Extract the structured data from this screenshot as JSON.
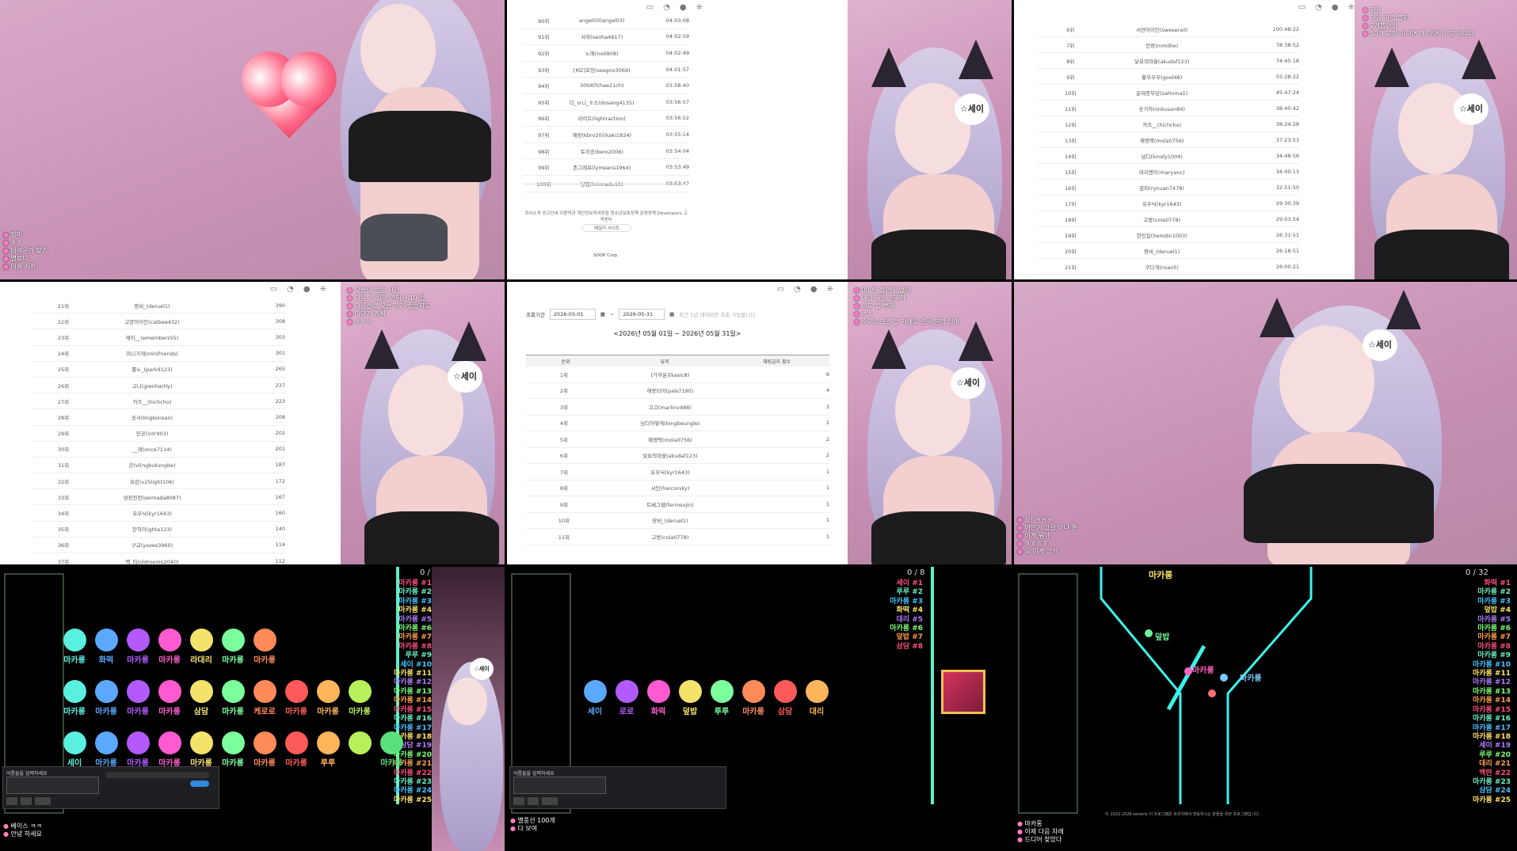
{
  "panel1": {
    "chat": [
      "장미",
      "ㅎㅎ",
      "어려운거 찾기",
      "별로다",
      "이제 시작"
    ]
  },
  "panel2": {
    "rows": [
      {
        "rank": "90위",
        "name": "angel03(angel03)",
        "time": "04:03:08"
      },
      {
        "rank": "91위",
        "name": "서하(seoha4617)",
        "time": "04:02:59"
      },
      {
        "rank": "92위",
        "name": "노에(no0808)",
        "time": "04:02:49"
      },
      {
        "rank": "93위",
        "name": "[MZ]초잉(sesgno3069)",
        "time": "04:01:57"
      },
      {
        "rank": "94위",
        "name": "3004(fchae21ch)",
        "time": "03:58:40"
      },
      {
        "rank": "95위",
        "name": "디_ㅂ니_ㅎ스(dosang4135)",
        "time": "03:56:57"
      },
      {
        "rank": "96위",
        "name": "라이트(lightraction)",
        "time": "03:56:52"
      },
      {
        "rank": "97위",
        "name": "해랑(kbrv20)(kaki1824)",
        "time": "03:55:14"
      },
      {
        "rank": "98위",
        "name": "토끼공(bero2006)",
        "time": "03:54:04"
      },
      {
        "rank": "99위",
        "name": "존그래프(lymeans1964)",
        "time": "03:53:49"
      },
      {
        "rank": "100위",
        "name": "당첨(hinmadu10)",
        "time": "03:53:47"
      }
    ],
    "footer_links": "회사소개  광고안내  이용약관  개인정보처리방침  청소년보호정책  운영정책  Developers  고객센터",
    "footer_button": "패밀리 사이트",
    "brand": "SOOP Corp."
  },
  "panel3": {
    "rows": [
      {
        "rank": "6위",
        "name": "서연아이인(sweserail)",
        "time": "100:48:22"
      },
      {
        "rank": "7위",
        "name": "민랑(mmillie)",
        "time": "78:38:52"
      },
      {
        "rank": "8위",
        "name": "닻묘의마을(akudaf123)",
        "time": "74:45:18"
      },
      {
        "rank": "9위",
        "name": "황우우우(gool48)",
        "time": "55:28:22"
      },
      {
        "rank": "10위",
        "name": "운래종무당(sahnma1)",
        "time": "45:47:24"
      },
      {
        "rank": "11위",
        "name": "송가하(onkusan84)",
        "time": "38:40:42"
      },
      {
        "rank": "12위",
        "name": "카즈__(hichcho)",
        "time": "38:24:28"
      },
      {
        "rank": "13위",
        "name": "해영택(mola0756)",
        "time": "37:23:53"
      },
      {
        "rank": "14위",
        "name": "넘디(kinsly1004)",
        "time": "34:48:56"
      },
      {
        "rank": "15위",
        "name": "마리앤이(maryanc)",
        "time": "34:00:13"
      },
      {
        "rank": "16위",
        "name": "준타(rynuan7478)",
        "time": "32:51:50"
      },
      {
        "rank": "17위",
        "name": "유우닉(kyr1643)",
        "time": "29:30:39"
      },
      {
        "rank": "18위",
        "name": "고랑(cola0778)",
        "time": "29:03:54"
      },
      {
        "rank": "19위",
        "name": "한민집(hemdin1003)",
        "time": "26:31:51"
      },
      {
        "rank": "20위",
        "name": "팡비_(deruel1)",
        "time": "26:18:51"
      },
      {
        "rank": "21위",
        "name": "쿠다게(nsao5)",
        "time": "26:00:21"
      },
      {
        "rank": "22위",
        "name": "구그아(kimhvan)",
        "time": "24:16:27"
      }
    ],
    "chat": [
      "자유",
      "다음 이것 뽑기",
      "2개뽑아봐",
      "50개 교환 아니면 개 하면 거 또 아니다"
    ]
  },
  "panel4": {
    "rows": [
      {
        "rank": "21위",
        "name": "팡비_(deruel1)",
        "count": "390"
      },
      {
        "rank": "22위",
        "name": "고양이이인(catbee432)",
        "count": "308"
      },
      {
        "rank": "23위",
        "name": "케이__(emembers55)",
        "count": "303"
      },
      {
        "rank": "24위",
        "name": "미니가게(minifriends)",
        "count": "301"
      },
      {
        "rank": "25위",
        "name": "롤노_(park9123)",
        "count": "265"
      },
      {
        "rank": "26위",
        "name": "고니(grenhartly)",
        "count": "237"
      },
      {
        "rank": "27위",
        "name": "카즈__(hichcho)",
        "count": "223"
      },
      {
        "rank": "28위",
        "name": "송사(lingkonsan)",
        "count": "208"
      },
      {
        "rank": "29위",
        "name": "인공(intr903)",
        "count": "202"
      },
      {
        "rank": "30위",
        "name": "__래(once7114)",
        "count": "201"
      },
      {
        "rank": "31위",
        "name": "강(vl(ngbuksngbe)",
        "count": "187"
      },
      {
        "rank": "32위",
        "name": "유린(v25light106)",
        "count": "172"
      },
      {
        "rank": "33위",
        "name": "냉정전전(seimada8087)",
        "count": "167"
      },
      {
        "rank": "34위",
        "name": "유우닉(kyr1643)",
        "count": "160"
      },
      {
        "rank": "35위",
        "name": "찬히아(ghta123)",
        "count": "140"
      },
      {
        "rank": "36위",
        "name": "구교(yaxes3960)",
        "count": "114"
      },
      {
        "rank": "37위",
        "name": "백_미(oldmemo2040)",
        "count": "112"
      }
    ],
    "chat": [
      "오늘의 방송 시간",
      "다음 거 뭘까 안되서 10 걸",
      "다음걸로 오늘 하기 좋을지도",
      "이야기 계획",
      "ㅎㅎㅎ"
    ]
  },
  "panel5": {
    "period_label": "조회기간",
    "date_from": "2026-05-01",
    "date_to": "2026-05-31",
    "period_note": "최근 1년 데이터만 조회 가능합니다.",
    "heading": "<2026년 05월 01일 ~ 2026년 05월 31일>",
    "columns": [
      "순위",
      "유저",
      "채팅금지 횟수"
    ],
    "rows": [
      {
        "rank": "1위",
        "name": "[가까운](kasic8)",
        "count": "9"
      },
      {
        "rank": "2위",
        "name": "해랑되어(pals7190)",
        "count": "4"
      },
      {
        "rank": "3위",
        "name": "끄끄(marlinv488)",
        "count": "3"
      },
      {
        "rank": "4위",
        "name": "넘디어떻게(longbeungle)",
        "count": "2"
      },
      {
        "rank": "5위",
        "name": "해영택(mola0756)",
        "count": "2"
      },
      {
        "rank": "6위",
        "name": "닻묘의마을(akudaf123)",
        "count": "2"
      },
      {
        "rank": "7위",
        "name": "유우닉(kyr1643)",
        "count": "1"
      },
      {
        "rank": "8위",
        "name": "서민(harcorsky)",
        "count": "1"
      },
      {
        "rank": "9위",
        "name": "트베그웹(ferrosojin)",
        "count": "1"
      },
      {
        "rank": "10위",
        "name": "팡비_(deruel1)",
        "count": "1"
      },
      {
        "rank": "11위",
        "name": "고랑(cola0778)",
        "count": "1"
      }
    ],
    "chat": [
      "00 한 잠깐에 없대",
      "내가 제일 진짜에",
      "나도 할 뻔해",
      "ㅎㅎ",
      "주의 0.3일 할 거예요 결국 분명 있어"
    ]
  },
  "panel6": {
    "chat": [
      "오! ㅋㅋㅋ",
      "어떤거 그걸 아냐 뭔",
      "이게 뭐야",
      "ㅎㅎㅎㅎ",
      "오 이게 그거"
    ]
  },
  "panel7": {
    "count": "0 / 27",
    "rank_list": [
      "마카롱 #1",
      "마카롱 #2",
      "마카롱 #3",
      "마카롱 #4",
      "마카롱 #5",
      "마카롱 #6",
      "마카롱 #7",
      "마카롱 #8",
      "루루 #9",
      "세이 #10",
      "마카롱 #11",
      "마카롱 #12",
      "마카롱 #13",
      "마카롱 #14",
      "마카롱 #15",
      "마카롱 #16",
      "마카롱 #17",
      "마카롱 #18",
      "삼담 #19",
      "마카롱 #20",
      "마카롱 #21",
      "마카롱 #22",
      "마카롱 #23",
      "마카롱 #24",
      "마카롱 #25"
    ],
    "row1": [
      "마카롱",
      "화떡",
      "마카롱",
      "마카롱",
      "라대리",
      "마카롱",
      "마카롱"
    ],
    "row2": [
      "마카롱",
      "마카롱",
      "마카롱",
      "마카롱",
      "삼담",
      "마카롱",
      "케로로",
      "마카롱",
      "마카롱",
      "마카롱"
    ],
    "row3": [
      "세이",
      "마카롱",
      "마카롱",
      "마카롱",
      "마카롱",
      "마카롱",
      "마카롱",
      "마카롱",
      "루루",
      "",
      "마카롱"
    ],
    "input_label": "이름들을 입력하세요",
    "chat": [
      "베이스 ㅋㅋ",
      "안녕 하세요"
    ]
  },
  "panel8": {
    "count": "0 / 8",
    "rank_list": [
      "세이 #1",
      "루루 #2",
      "마카롱 #3",
      "화떡 #4",
      "대리 #5",
      "마카롱 #6",
      "덮밥 #7",
      "삼담 #8"
    ],
    "balls": [
      "세이",
      "로로",
      "화떡",
      "덮밥",
      "루루",
      "마카롱",
      "삼담",
      "대리"
    ],
    "input_label": "이름들을 입력하세요",
    "chat": [
      "별풍선 100개",
      "다 보여"
    ]
  },
  "panel9": {
    "count": "0 / 32",
    "top_label": "마카롱",
    "labels": [
      "덮밥",
      "마카롱",
      "마카롱"
    ],
    "rank_list": [
      "화떡 #1",
      "마카롱 #2",
      "마카롱 #3",
      "덮밥 #4",
      "마카롱 #5",
      "마카롱 #6",
      "마카롱 #7",
      "마카롱 #8",
      "마카롱 #9",
      "마카롱 #10",
      "마카롱 #11",
      "마카롱 #12",
      "마카롱 #13",
      "마카롱 #14",
      "마카롱 #15",
      "마카롱 #16",
      "마카롱 #17",
      "마카롱 #18",
      "세이 #19",
      "루루 #20",
      "대리 #21",
      "백란 #22",
      "마카롱 #23",
      "삼담 #24",
      "마카롱 #25"
    ],
    "chat": [
      "마카롱",
      "이제 다음 차례",
      "드디어 찾았다"
    ]
  },
  "badge_text": "☆세이",
  "footer_copyright": "© 2022-2026 kenerix 이 프로그램은 트위치에서 방송하시는 분들을 위한 프로그램입니다."
}
